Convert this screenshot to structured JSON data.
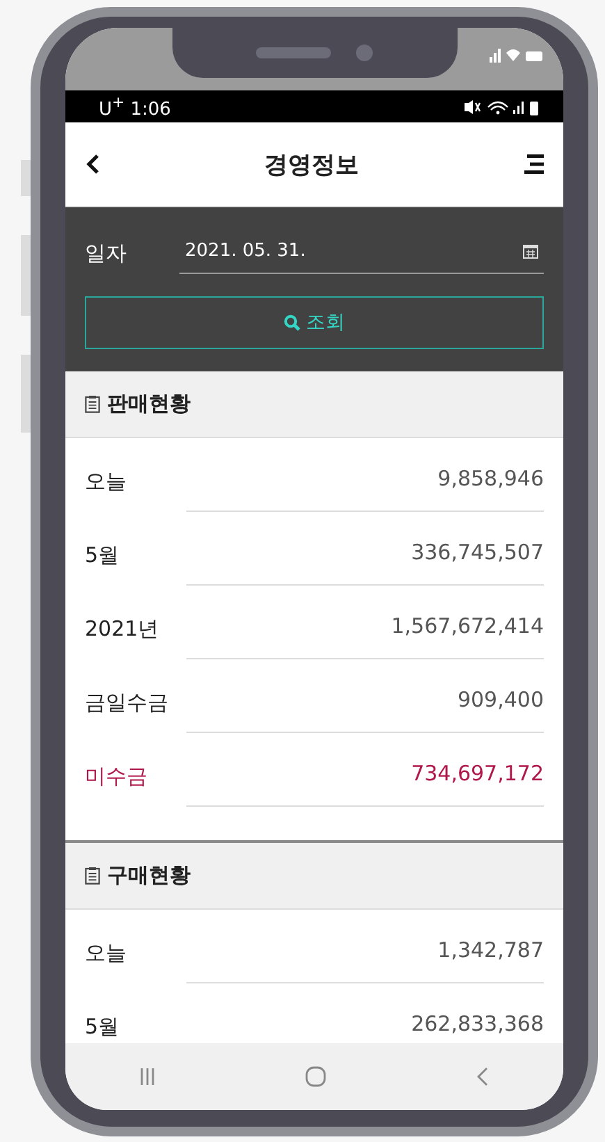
{
  "status_bar": {
    "carrier_time": "U$^{+}$ 1:06"
  },
  "header": {
    "title": "경영정보"
  },
  "filter": {
    "label": "일자",
    "date_value": "2021. 05. 31.",
    "search_button": "조회"
  },
  "sections": [
    {
      "title": "판매현황",
      "rows": [
        {
          "label": "오늘",
          "value": "9,858,946",
          "emphasis": false
        },
        {
          "label": "5월",
          "value": "336,745,507",
          "emphasis": false
        },
        {
          "label": "2021년",
          "value": "1,567,672,414",
          "emphasis": false
        },
        {
          "label": "금일수금",
          "value": "909,400",
          "emphasis": false
        },
        {
          "label": "미수금",
          "value": "734,697,172",
          "emphasis": true
        }
      ]
    },
    {
      "title": "구매현황",
      "rows": [
        {
          "label": "오늘",
          "value": "1,342,787",
          "emphasis": false
        },
        {
          "label": "5월",
          "value": "262,833,368",
          "emphasis": false
        }
      ]
    }
  ]
}
